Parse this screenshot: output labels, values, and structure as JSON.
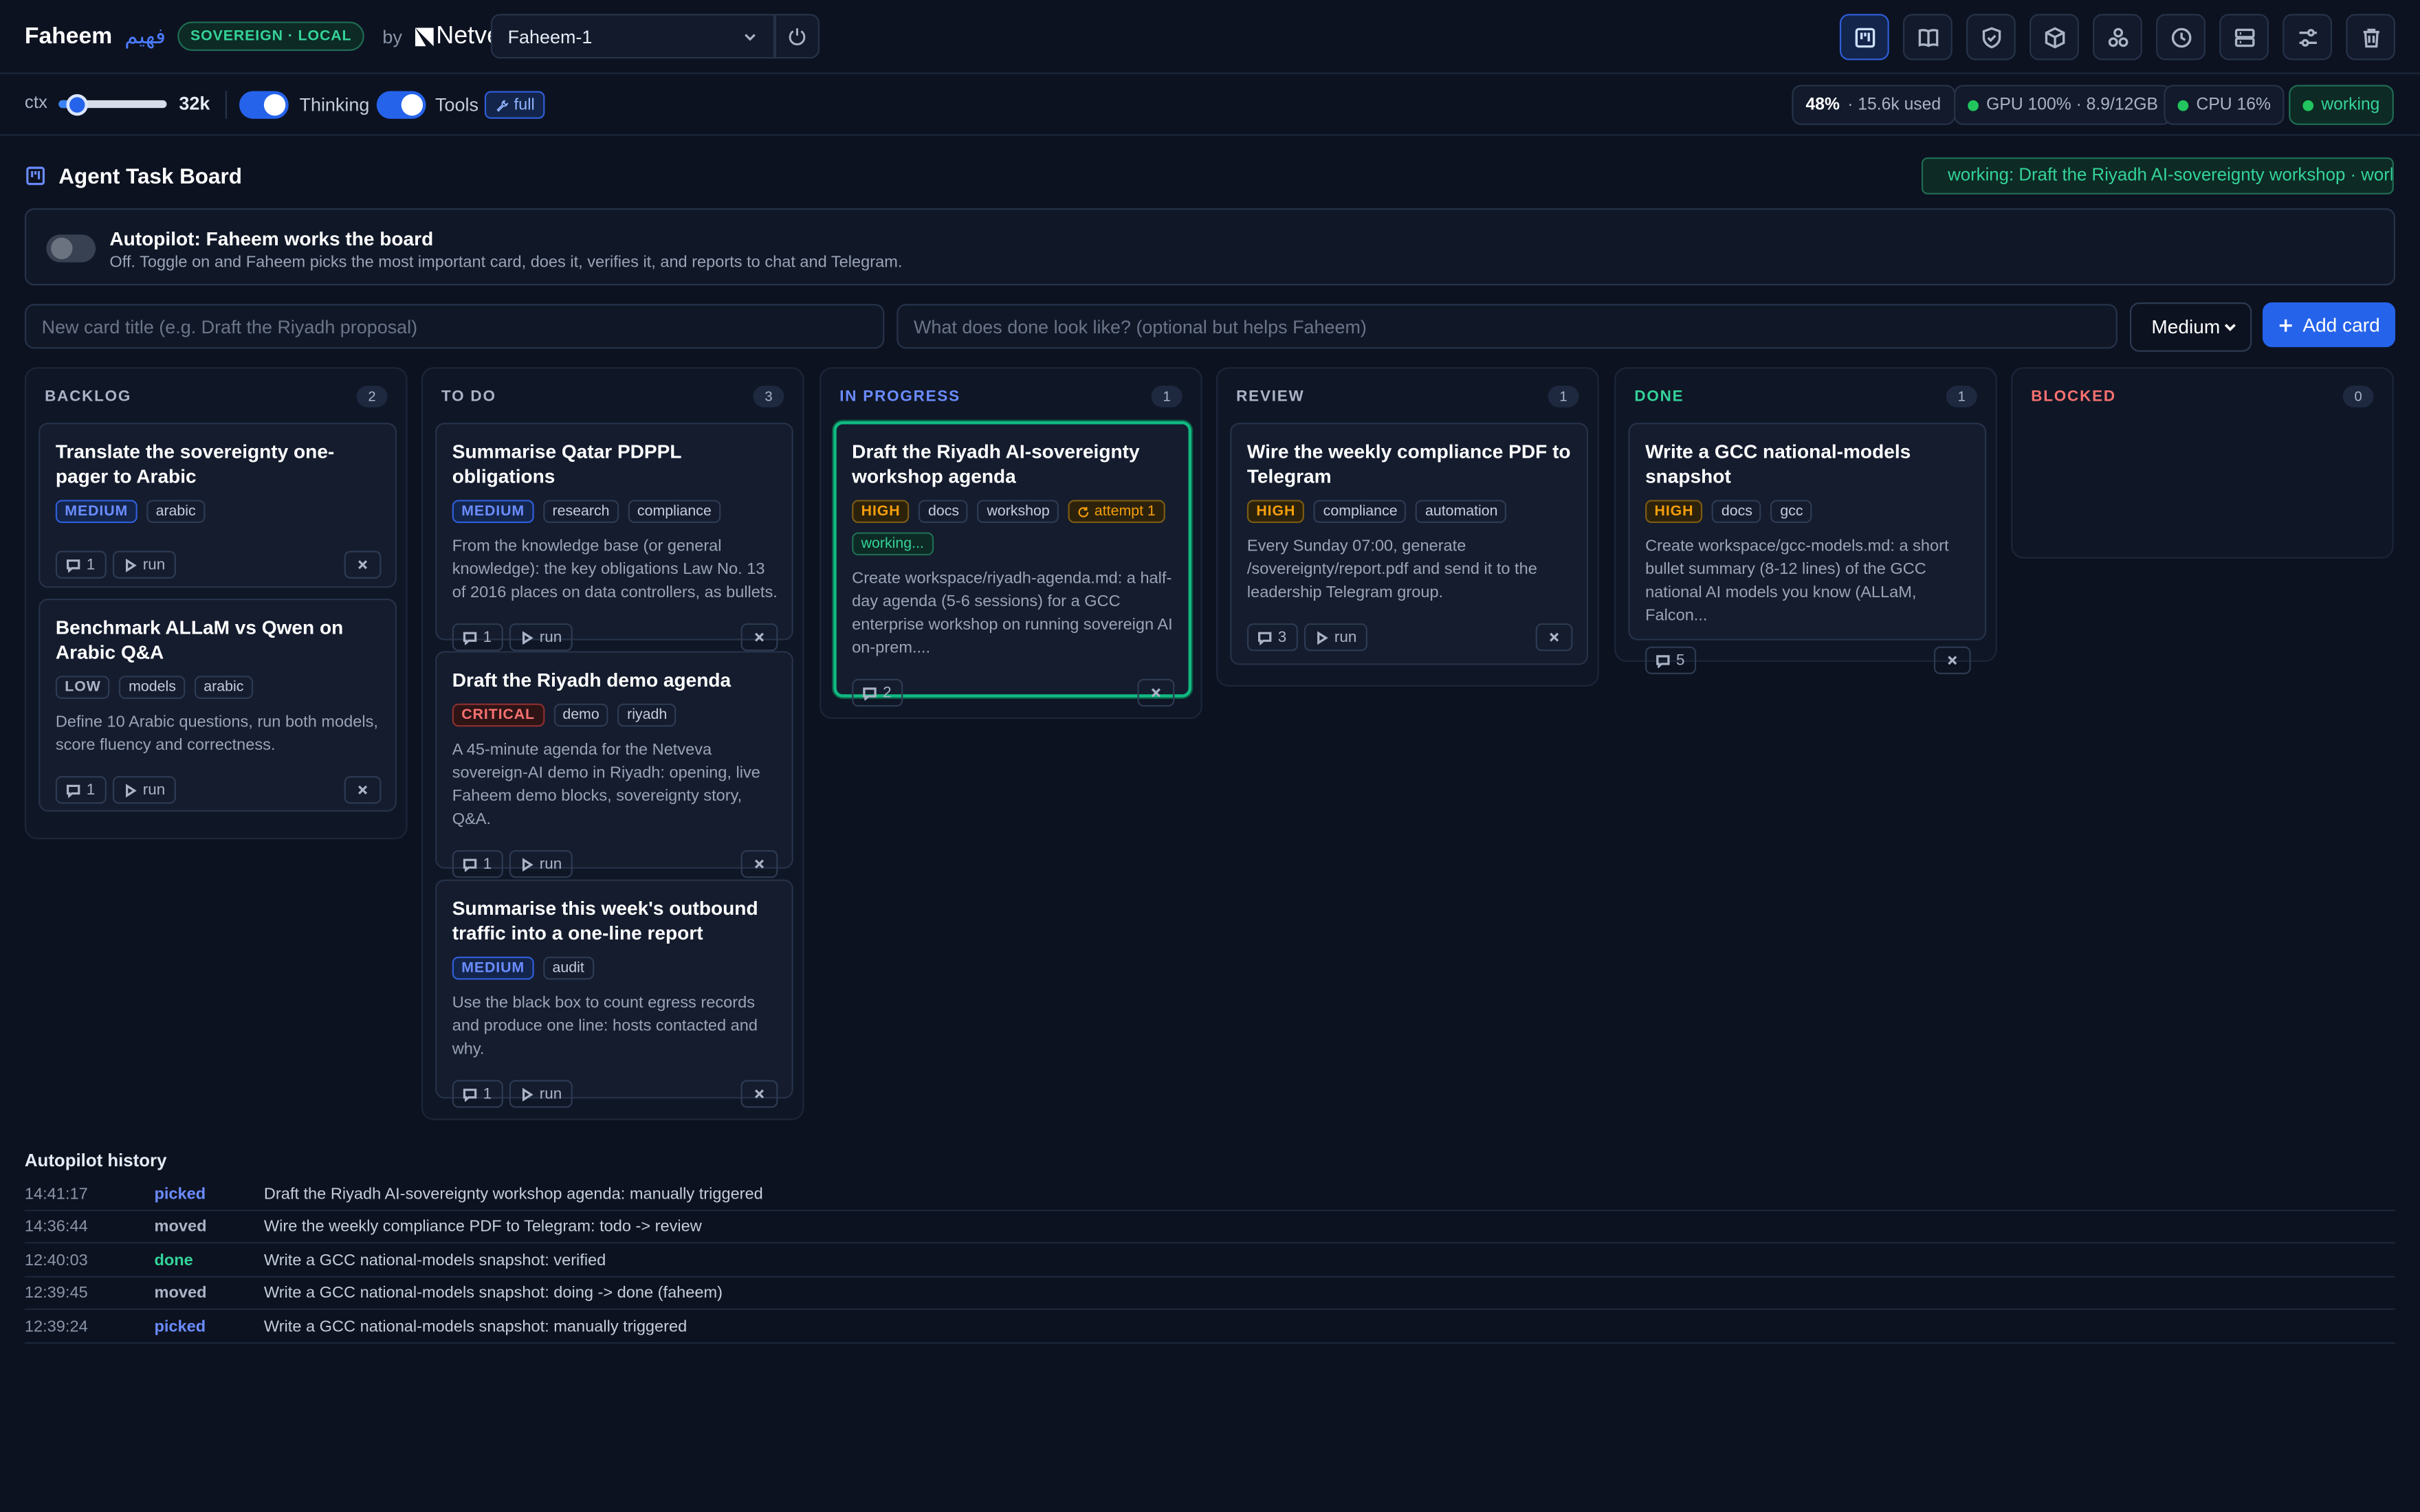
{
  "brand": {
    "name": "Faheem",
    "arabic": "فهيم",
    "badge": "SOVEREIGN · LOCAL",
    "by": "by",
    "vendor": "Netveva"
  },
  "model": {
    "selected": "Faheem-1"
  },
  "toolbar": {
    "icons": [
      "board-icon",
      "book-icon",
      "shield-icon",
      "cube-icon",
      "nodes-icon",
      "clock-icon",
      "server-icon",
      "sliders-icon",
      "trash-icon"
    ]
  },
  "controls": {
    "ctx_label": "ctx",
    "ctx_value": "32k",
    "ctx_fraction": 0.17,
    "thinking_label": "Thinking",
    "thinking_on": true,
    "tools_label": "Tools",
    "tools_on": true,
    "tools_mode": "full"
  },
  "stats": {
    "usage_pct": "48%",
    "usage_text": "· 15.6k used",
    "gpu": "GPU 100% · 8.9/12GB",
    "cpu": "CPU 16%",
    "status": "working"
  },
  "board": {
    "title": "Agent Task Board",
    "working_status": "working: Draft the Riyadh AI-sovereignty workshop · work",
    "autopilot_title": "Autopilot: Faheem works the board",
    "autopilot_desc": "Off. Toggle on and Faheem picks the most important card, does it, verifies it, and reports to chat and Telegram.",
    "new_title_placeholder": "New card title (e.g. Draft the Riyadh proposal)",
    "new_done_placeholder": "What does done look like? (optional but helps Faheem)",
    "priority_selected": "Medium",
    "add_label": "Add card"
  },
  "columns": [
    {
      "title": "BACKLOG",
      "count": "2",
      "cards": [
        {
          "title": "Translate the sovereignty one-pager to Arabic",
          "priority": "MEDIUM",
          "tags": [
            "arabic"
          ],
          "desc": "",
          "comments": "1",
          "run": "run"
        },
        {
          "title": "Benchmark ALLaM vs Qwen on Arabic Q&A",
          "priority": "LOW",
          "tags": [
            "models",
            "arabic"
          ],
          "desc": "Define 10 Arabic questions, run both models, score fluency and correctness.",
          "comments": "1",
          "run": "run"
        }
      ]
    },
    {
      "title": "TO DO",
      "count": "3",
      "cards": [
        {
          "title": "Summarise Qatar PDPPL obligations",
          "priority": "MEDIUM",
          "tags": [
            "research",
            "compliance"
          ],
          "desc": "From the knowledge base (or general knowledge): the key obligations Law No. 13 of 2016 places on data controllers, as bullets.",
          "comments": "1",
          "run": "run"
        },
        {
          "title": "Draft the Riyadh demo agenda",
          "priority": "CRITICAL",
          "tags": [
            "demo",
            "riyadh"
          ],
          "desc": "A 45-minute agenda for the Netveva sovereign-AI demo in Riyadh: opening, live Faheem demo blocks, sovereignty story, Q&A.",
          "comments": "1",
          "run": "run"
        },
        {
          "title": "Summarise this week's outbound traffic into a one-line report",
          "priority": "MEDIUM",
          "tags": [
            "audit"
          ],
          "desc": "Use the black box to count egress records and produce one line: hosts contacted and why.",
          "comments": "1",
          "run": "run"
        }
      ]
    },
    {
      "title": "IN PROGRESS",
      "count": "1",
      "cards": [
        {
          "title": "Draft the Riyadh AI-sovereignty workshop agenda",
          "priority": "HIGH",
          "tags": [
            "docs",
            "workshop"
          ],
          "attempt": "attempt 1",
          "working": "working...",
          "desc": "Create workspace/riyadh-agenda.md: a half-day agenda (5-6 sessions) for a GCC enterprise workshop on running sovereign AI on-prem....",
          "comments": "2"
        }
      ]
    },
    {
      "title": "REVIEW",
      "count": "1",
      "cards": [
        {
          "title": "Wire the weekly compliance PDF to Telegram",
          "priority": "HIGH",
          "tags": [
            "compliance",
            "automation"
          ],
          "desc": "Every Sunday 07:00, generate /sovereignty/report.pdf and send it to the leadership Telegram group.",
          "comments": "3",
          "run": "run"
        }
      ]
    },
    {
      "title": "DONE",
      "count": "1",
      "cards": [
        {
          "title": "Write a GCC national-models snapshot",
          "priority": "HIGH",
          "tags": [
            "docs",
            "gcc"
          ],
          "desc": "Create workspace/gcc-models.md: a short bullet summary (8-12 lines) of the GCC national AI models you know (ALLaM, Falcon...",
          "comments": "5"
        }
      ]
    },
    {
      "title": "BLOCKED",
      "count": "0",
      "cards": []
    }
  ],
  "history": {
    "title": "Autopilot history",
    "rows": [
      {
        "time": "14:41:17",
        "action": "picked",
        "msg": "Draft the Riyadh AI-sovereignty workshop agenda: manually triggered"
      },
      {
        "time": "14:36:44",
        "action": "moved",
        "msg": "Wire the weekly compliance PDF to Telegram: todo -> review"
      },
      {
        "time": "12:40:03",
        "action": "done",
        "msg": "Write a GCC national-models snapshot: verified"
      },
      {
        "time": "12:39:45",
        "action": "moved",
        "msg": "Write a GCC national-models snapshot: doing -> done (faheem)"
      },
      {
        "time": "12:39:24",
        "action": "picked",
        "msg": "Write a GCC national-models snapshot: manually triggered"
      }
    ]
  }
}
